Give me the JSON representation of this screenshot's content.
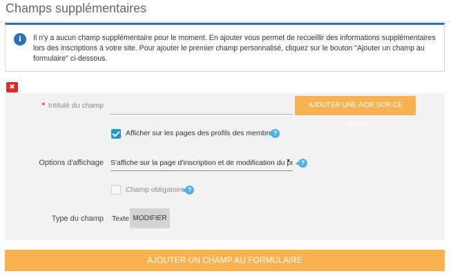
{
  "page": {
    "title": "Champs supplémentaires"
  },
  "info": {
    "icon": "info-icon",
    "text": "Il n'y a aucun champ supplémentaire pour le moment. En ajouter vous permet de recueillir des informations supplémentaires lors des inscriptions à votre site. Pour ajouter le premier champ personnalisé, cliquez sur le bouton \"Ajouter un champ au formulaire\" ci-dessous."
  },
  "field": {
    "remove_icon": "close-icon",
    "required_star": "*",
    "label_text": "Intitulé du champ",
    "label_value": "",
    "help_button": "Ajouter une aide sur ce champ",
    "show_on_profiles": {
      "label": "Afficher sur les pages des profils des membres",
      "checked": true
    },
    "display_options": {
      "label": "Options d'affichage",
      "selected": "S'affiche sur la page d'inscription et de modification du pro"
    },
    "mandatory": {
      "label": "Champ obligatoire",
      "checked": false
    },
    "type": {
      "label": "Type du champ",
      "value": "Texte",
      "modify_button": "Modifier"
    }
  },
  "add_button": "Ajouter un champ au formulaire",
  "colors": {
    "accent_orange": "#f8b24f",
    "info_blue": "#2f6fb7",
    "check_blue": "#2196d8",
    "remove_red": "#e02a2a",
    "help_icon_blue": "#4fb0e8"
  }
}
